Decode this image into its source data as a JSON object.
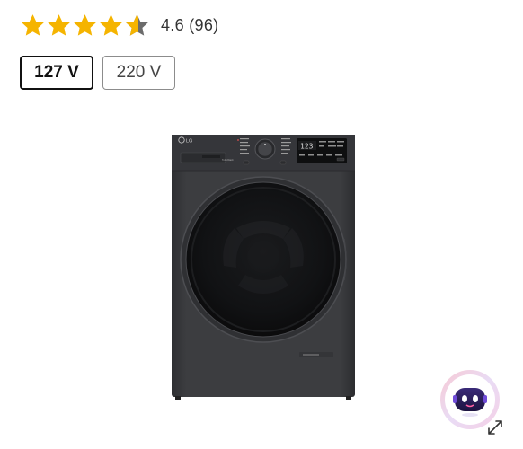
{
  "rating": {
    "value": 4.6,
    "max": 5,
    "display": "4.6 (96)",
    "star_color": "#f5b400",
    "empty_color": "#6b6b6b"
  },
  "voltage_options": [
    {
      "label": "127 V",
      "selected": true
    },
    {
      "label": "220 V",
      "selected": false
    }
  ],
  "product": {
    "brand_logo": "LG",
    "display_readout": "123",
    "body_color": "#3a3b3e"
  },
  "assistant": {
    "icon": "robot-assistant-icon",
    "expand_icon": "expand-arrows-icon"
  }
}
